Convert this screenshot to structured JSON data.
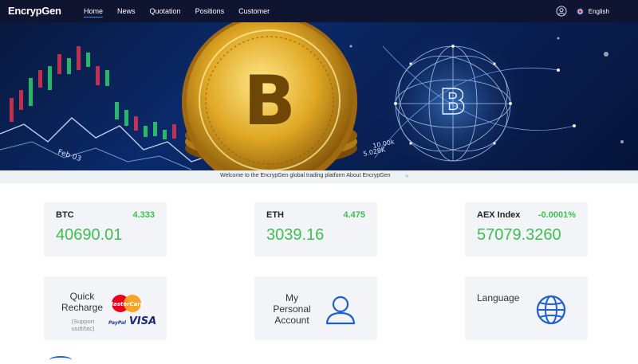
{
  "app": {
    "logo_text": "EncrypGen"
  },
  "nav": {
    "items": [
      {
        "label": "Home",
        "active": true
      },
      {
        "label": "News"
      },
      {
        "label": "Quotation"
      },
      {
        "label": "Positions"
      },
      {
        "label": "Customer"
      }
    ],
    "user_icon": "user-circle-icon",
    "language": "English"
  },
  "banner": {
    "coin_symbol": "B",
    "chart_labels": [
      "Feb 03",
      "10.00k",
      "5.028K"
    ]
  },
  "ticker": {
    "text": "Welcome to the EncrypGen global trading platform About EncrypGen",
    "arrow": "»"
  },
  "prices": [
    {
      "name": "BTC",
      "change": "4.333",
      "price": "40690.01"
    },
    {
      "name": "ETH",
      "change": "4.475",
      "price": "3039.16"
    },
    {
      "name": "AEX Index",
      "change": "-0.0001%",
      "price": "57079.3260"
    }
  ],
  "features": {
    "recharge": {
      "title": "Quick Recharge",
      "subtitle": "(Support usdt/btc)",
      "brand_mastercard": "MasterCard",
      "brand_paypal": "PayPal",
      "brand_visa": "VISA"
    },
    "account": {
      "title": "My Personal Account"
    },
    "language": {
      "title": "Language"
    }
  },
  "colors": {
    "nav_bg": "#0f1530",
    "positive": "#3cc04f",
    "card_bg": "#f3f4f8",
    "icon_blue": "#1e5fd1"
  }
}
